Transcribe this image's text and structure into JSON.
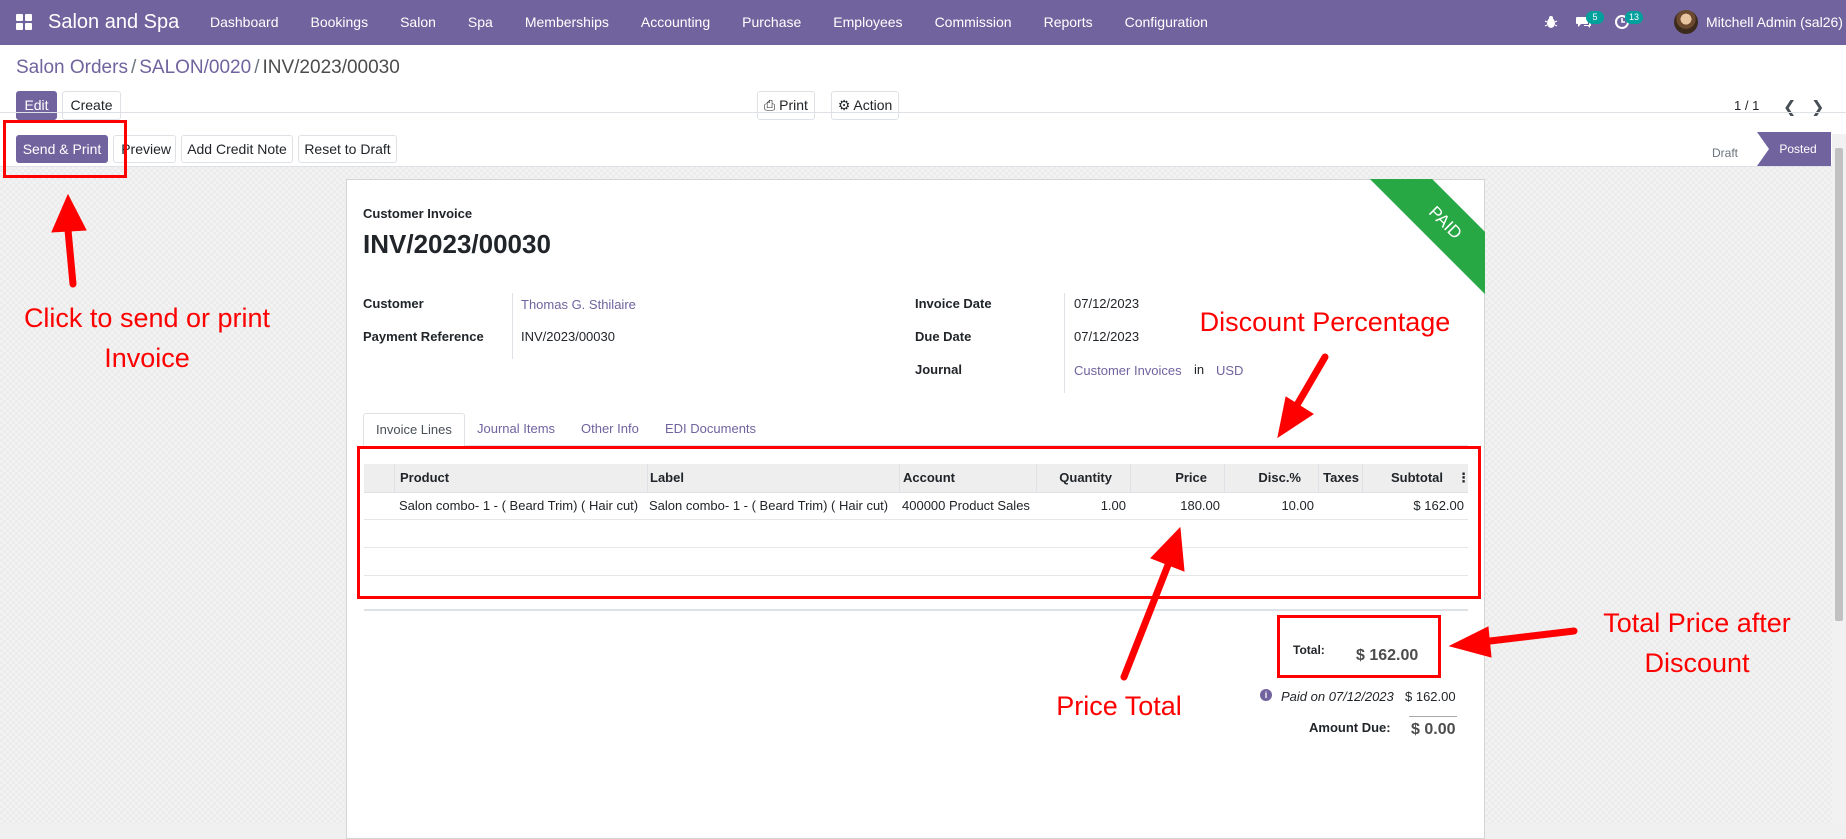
{
  "navbar": {
    "brand": "Salon and Spa",
    "menu": [
      "Dashboard",
      "Bookings",
      "Salon",
      "Spa",
      "Memberships",
      "Accounting",
      "Purchase",
      "Employees",
      "Commission",
      "Reports",
      "Configuration"
    ],
    "chat_badge": "5",
    "activity_badge": "13",
    "user": "Mitchell Admin (sal26)"
  },
  "breadcrumb": {
    "root": "Salon Orders",
    "middle": "SALON/0020",
    "current": "INV/2023/00030",
    "sep": "/"
  },
  "buttons": {
    "edit": "Edit",
    "create": "Create",
    "print": "Print",
    "action": "Action",
    "send_print": "Send & Print",
    "preview": "Preview",
    "credit_note": "Add Credit Note",
    "reset_draft": "Reset to Draft"
  },
  "pager": "1 / 1",
  "status": {
    "draft": "Draft",
    "posted": "Posted"
  },
  "invoice": {
    "type": "Customer Invoice",
    "number": "INV/2023/00030",
    "ribbon": "PAID",
    "customer_label": "Customer",
    "customer": "Thomas G. Sthilaire",
    "payment_ref_label": "Payment Reference",
    "payment_ref": "INV/2023/00030",
    "invoice_date_label": "Invoice Date",
    "invoice_date": "07/12/2023",
    "due_date_label": "Due Date",
    "due_date": "07/12/2023",
    "journal_label": "Journal",
    "journal": "Customer Invoices",
    "journal_in": "in",
    "currency": "USD"
  },
  "tabs": [
    "Invoice Lines",
    "Journal Items",
    "Other Info",
    "EDI Documents"
  ],
  "table": {
    "headers": [
      "Product",
      "Label",
      "Account",
      "Quantity",
      "Price",
      "Disc.%",
      "Taxes",
      "Subtotal"
    ],
    "rows": [
      {
        "product": "Salon combo- 1 - ( Beard Trim) ( Hair cut)",
        "label": "Salon combo- 1 -  ( Beard Trim) ( Hair cut)",
        "account": "400000 Product Sales",
        "quantity": "1.00",
        "price": "180.00",
        "discount": "10.00",
        "taxes": "",
        "subtotal": "$ 162.00"
      }
    ]
  },
  "totals": {
    "total_label": "Total:",
    "total": "$ 162.00",
    "paid_on": "Paid on 07/12/2023",
    "paid_amount": "$ 162.00",
    "amount_due_label": "Amount Due:",
    "amount_due": "$ 0.00"
  },
  "annotations": {
    "send_print": "Click to send or print Invoice",
    "discount": "Discount Percentage",
    "price_total": "Price Total",
    "total_after": "Total Price after Discount",
    "color": "#ff0000"
  },
  "colors": {
    "brand": "#71639e",
    "paid": "#28a745"
  }
}
